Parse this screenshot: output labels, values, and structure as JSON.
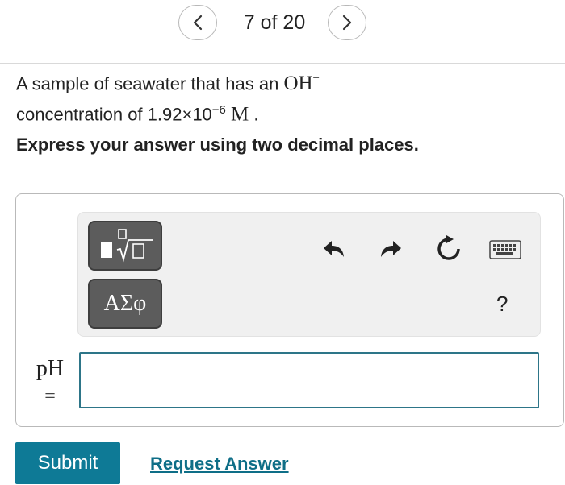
{
  "nav": {
    "prev_icon": "chevron-left-icon",
    "next_icon": "chevron-right-icon",
    "counter": "7 of 20"
  },
  "question": {
    "part1": "A sample of seawater that has an",
    "ion": "OH",
    "ion_charge": "−",
    "part2": "concentration of 1.92×10",
    "exponent": "−6",
    "unit": "M",
    "end": "."
  },
  "instruction": "Express your answer using two decimal places.",
  "toolbar": {
    "templates_icon": "templates-icon",
    "symbols_label": "ΑΣφ",
    "undo_icon": "undo-icon",
    "redo_icon": "redo-icon",
    "reset_icon": "reset-icon",
    "keyboard_icon": "keyboard-icon",
    "help_label": "?"
  },
  "answer": {
    "label": "pH",
    "equals": "=",
    "value": ""
  },
  "buttons": {
    "submit": "Submit",
    "request_answer": "Request Answer"
  },
  "colors": {
    "accent": "#0e7a96",
    "link": "#0e6e87",
    "tool_button": "#5c5c5c",
    "toolbar_bg": "#f0f0f0"
  }
}
